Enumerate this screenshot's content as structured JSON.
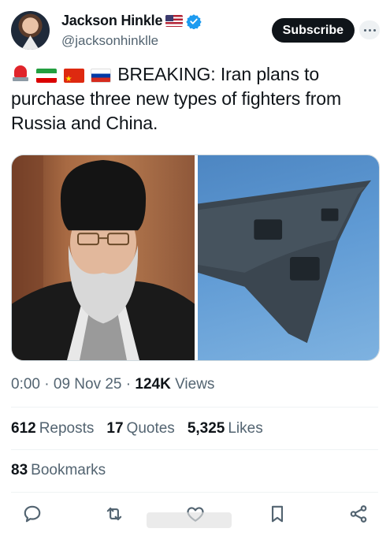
{
  "author": {
    "display_name": "Jackson Hinkle",
    "handle": "@jacksonhinklle",
    "flag_icon": "us-flag-icon",
    "verified_icon": "verified-badge-icon"
  },
  "header": {
    "subscribe_label": "Subscribe",
    "more_icon": "more-icon"
  },
  "tweet": {
    "emoji_icons": [
      "siren-icon",
      "iran-flag-icon",
      "china-flag-icon",
      "russia-flag-icon"
    ],
    "text": "BREAKING: Iran plans to purchase three new types of fighters from Russia and China."
  },
  "media": {
    "left_image": "portrait of a cleric in black turban and white beard",
    "right_image": "stealth fighter jet against blue sky"
  },
  "meta": {
    "time": "0:00",
    "sep1": "·",
    "date": "09 Nov 25",
    "sep2": "·",
    "views_count": "124K",
    "views_label": "Views"
  },
  "stats": {
    "reposts_count": "612",
    "reposts_label": "Reposts",
    "quotes_count": "17",
    "quotes_label": "Quotes",
    "likes_count": "5,325",
    "likes_label": "Likes"
  },
  "bookmarks": {
    "count": "83",
    "label": "Bookmarks"
  },
  "actions": [
    "reply-icon",
    "retweet-icon",
    "like-icon",
    "bookmark-icon",
    "share-icon"
  ],
  "colors": {
    "text": "#0f1419",
    "secondary": "#536471",
    "verified": "#1d9bf0",
    "divider": "#eff3f4"
  }
}
